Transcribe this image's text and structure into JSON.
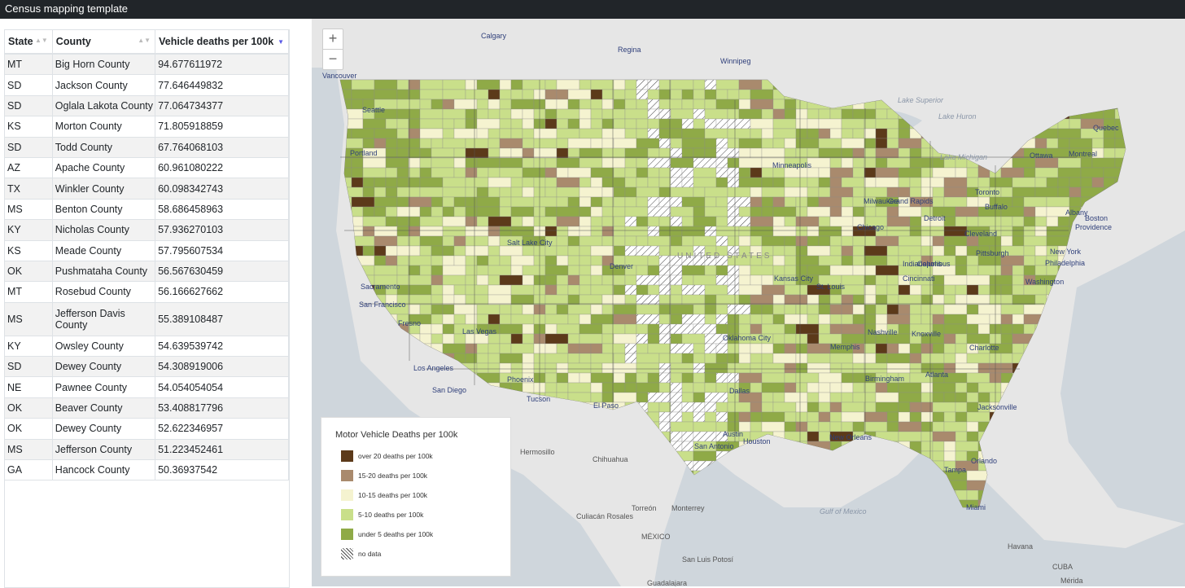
{
  "app": {
    "title": "Census mapping template"
  },
  "table": {
    "headers": [
      "State",
      "County",
      "Vehicle deaths per 100k"
    ],
    "rows": [
      [
        "MT",
        "Big Horn County",
        "94.677611972"
      ],
      [
        "SD",
        "Jackson County",
        "77.646449832"
      ],
      [
        "SD",
        "Oglala Lakota County",
        "77.064734377"
      ],
      [
        "KS",
        "Morton County",
        "71.805918859"
      ],
      [
        "SD",
        "Todd County",
        "67.764068103"
      ],
      [
        "AZ",
        "Apache County",
        "60.961080222"
      ],
      [
        "TX",
        "Winkler County",
        "60.098342743"
      ],
      [
        "MS",
        "Benton County",
        "58.686458963"
      ],
      [
        "KY",
        "Nicholas County",
        "57.936270103"
      ],
      [
        "KS",
        "Meade County",
        "57.795607534"
      ],
      [
        "OK",
        "Pushmataha County",
        "56.567630459"
      ],
      [
        "MT",
        "Rosebud County",
        "56.166627662"
      ],
      [
        "MS",
        "Jefferson Davis County",
        "55.389108487"
      ],
      [
        "KY",
        "Owsley County",
        "54.639539742"
      ],
      [
        "SD",
        "Dewey County",
        "54.308919006"
      ],
      [
        "NE",
        "Pawnee County",
        "54.054054054"
      ],
      [
        "OK",
        "Beaver County",
        "53.408817796"
      ],
      [
        "OK",
        "Dewey County",
        "52.622346957"
      ],
      [
        "MS",
        "Jefferson County",
        "51.223452461"
      ],
      [
        "GA",
        "Hancock County",
        "50.36937542"
      ]
    ]
  },
  "map": {
    "zoom_in": "+",
    "zoom_out": "−",
    "colors": {
      "over20": "#5c3a1a",
      "c15_20": "#a98a6d",
      "c10_15": "#f5f3d0",
      "c5_10": "#c9df8a",
      "under5": "#8faa47",
      "nodata": "#ffffff",
      "land_outside": "#ececec",
      "water": "#cfd6dc"
    },
    "place_labels": [
      "Calgary",
      "Regina",
      "Winnipeg",
      "Vancouver",
      "Seattle",
      "Portland",
      "Minneapolis",
      "Milwaukee",
      "Grand Rapids",
      "Chicago",
      "Detroit",
      "Toronto",
      "Ottawa",
      "Montreal",
      "Quebec",
      "Buffalo",
      "Albany",
      "Boston",
      "Providence",
      "Cleveland",
      "Pittsburgh",
      "New York",
      "Philadelphia",
      "Washington",
      "Indianapolis",
      "Columbus",
      "Cincinnati",
      "Salt Lake City",
      "Denver",
      "Kansas City",
      "St. Louis",
      "Sacramento",
      "San Francisco",
      "Fresno",
      "Las Vegas",
      "Los Angeles",
      "San Diego",
      "Phoenix",
      "Tucson",
      "El Paso",
      "Oklahoma City",
      "Dallas",
      "Austin",
      "San Antonio",
      "Houston",
      "New Orleans",
      "Memphis",
      "Nashville",
      "Knoxville",
      "Charlotte",
      "Atlanta",
      "Birmingham",
      "Jacksonville",
      "Orlando",
      "Tampa",
      "Miami",
      "Hermosillo",
      "Chihuahua",
      "Torreón",
      "Monterrey",
      "Culiacán Rosales",
      "MÉXICO",
      "San Luis Potosí",
      "Guadalajara",
      "Havana",
      "CUBA",
      "Mérida",
      "UNITED STATES"
    ],
    "water_labels": [
      "Lake Superior",
      "Lake Huron",
      "Lake Michigan",
      "Gulf of Mexico"
    ]
  },
  "legend": {
    "title": "Motor Vehicle Deaths per 100k",
    "items": [
      {
        "label": "over 20 deaths per 100k",
        "color": "#5c3a1a"
      },
      {
        "label": "15-20 deaths per 100k",
        "color": "#a98a6d"
      },
      {
        "label": "10-15 deaths per 100k",
        "color": "#f5f3d0"
      },
      {
        "label": "5-10 deaths per 100k",
        "color": "#c9df8a"
      },
      {
        "label": "under 5 deaths per 100k",
        "color": "#8faa47"
      },
      {
        "label": "no data",
        "color": "#ffffff"
      }
    ]
  }
}
